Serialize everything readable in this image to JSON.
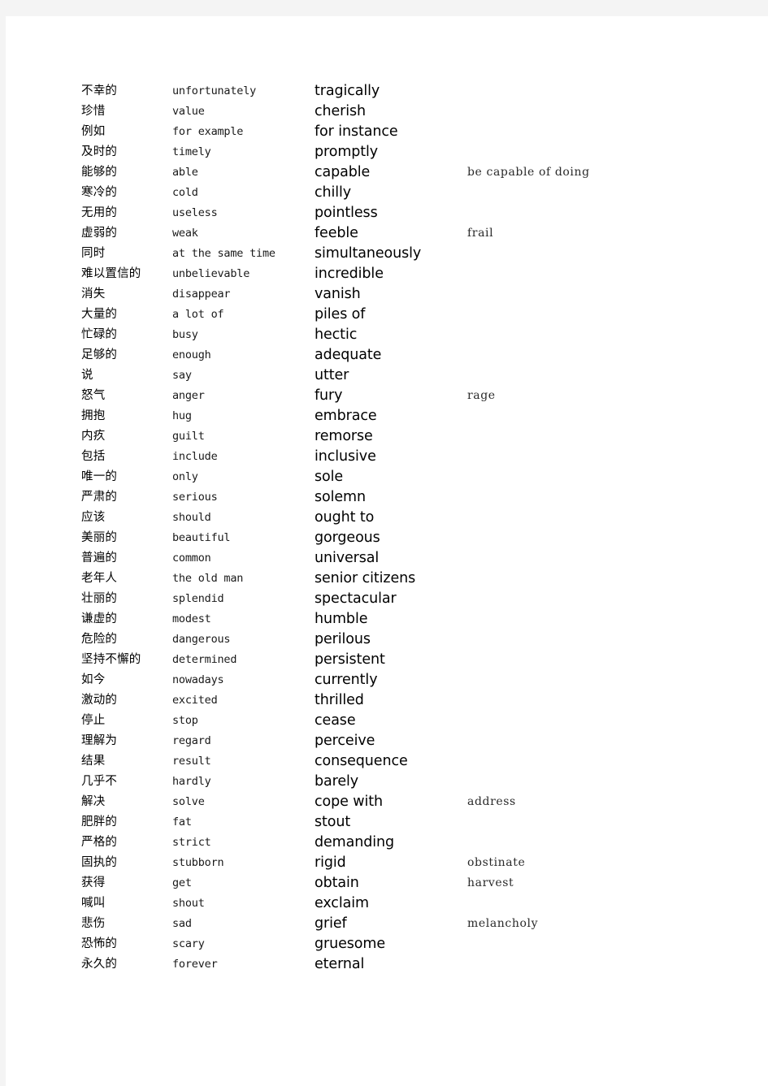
{
  "page": {
    "background_color": "#f4f4f4",
    "paper_color": "#ffffff"
  },
  "columns": {
    "chinese_header": "",
    "basic_header": "",
    "advanced_header": "",
    "extra_header": ""
  },
  "rows": [
    {
      "chinese": "不幸的",
      "basic": "unfortunately",
      "advanced": "tragically",
      "extra": ""
    },
    {
      "chinese": "珍惜",
      "basic": "value",
      "advanced": "cherish",
      "extra": ""
    },
    {
      "chinese": "例如",
      "basic": "for example",
      "advanced": "for instance",
      "extra": ""
    },
    {
      "chinese": "及时的",
      "basic": "timely",
      "advanced": "promptly",
      "extra": ""
    },
    {
      "chinese": "能够的",
      "basic": "able",
      "advanced": "capable",
      "extra": "be capable of doing"
    },
    {
      "chinese": "寒冷的",
      "basic": "cold",
      "advanced": "chilly",
      "extra": ""
    },
    {
      "chinese": "无用的",
      "basic": "useless",
      "advanced": "pointless",
      "extra": ""
    },
    {
      "chinese": "虚弱的",
      "basic": "weak",
      "advanced": "feeble",
      "extra": "frail"
    },
    {
      "chinese": "同时",
      "basic": "at the same time",
      "advanced": "simultaneously",
      "extra": ""
    },
    {
      "chinese": "难以置信的",
      "basic": "unbelievable",
      "advanced": "incredible",
      "extra": ""
    },
    {
      "chinese": "消失",
      "basic": "disappear",
      "advanced": "vanish",
      "extra": ""
    },
    {
      "chinese": "大量的",
      "basic": "a lot of",
      "advanced": "piles of",
      "extra": ""
    },
    {
      "chinese": "忙碌的",
      "basic": "busy",
      "advanced": "hectic",
      "extra": ""
    },
    {
      "chinese": "足够的",
      "basic": "enough",
      "advanced": "adequate",
      "extra": ""
    },
    {
      "chinese": "说",
      "basic": "say",
      "advanced": "utter",
      "extra": ""
    },
    {
      "chinese": "怒气",
      "basic": "anger",
      "advanced": "fury",
      "extra": "rage"
    },
    {
      "chinese": "拥抱",
      "basic": "hug",
      "advanced": "embrace",
      "extra": ""
    },
    {
      "chinese": "内疚",
      "basic": "guilt",
      "advanced": "remorse",
      "extra": ""
    },
    {
      "chinese": "包括",
      "basic": "include",
      "advanced": "inclusive",
      "extra": ""
    },
    {
      "chinese": "唯一的",
      "basic": "only",
      "advanced": "sole",
      "extra": ""
    },
    {
      "chinese": "严肃的",
      "basic": "serious",
      "advanced": "solemn",
      "extra": ""
    },
    {
      "chinese": "应该",
      "basic": "should",
      "advanced": "ought to",
      "extra": ""
    },
    {
      "chinese": "美丽的",
      "basic": "beautiful",
      "advanced": "gorgeous",
      "extra": ""
    },
    {
      "chinese": "普遍的",
      "basic": "common",
      "advanced": "universal",
      "extra": ""
    },
    {
      "chinese": "老年人",
      "basic": "the old man",
      "advanced": "senior citizens",
      "extra": ""
    },
    {
      "chinese": "壮丽的",
      "basic": "splendid",
      "advanced": "spectacular",
      "extra": ""
    },
    {
      "chinese": "谦虚的",
      "basic": "modest",
      "advanced": "humble",
      "extra": ""
    },
    {
      "chinese": "危险的",
      "basic": "dangerous",
      "advanced": "perilous",
      "extra": ""
    },
    {
      "chinese": "坚持不懈的",
      "basic": "determined",
      "advanced": "persistent",
      "extra": ""
    },
    {
      "chinese": "如今",
      "basic": "nowadays",
      "advanced": "currently",
      "extra": ""
    },
    {
      "chinese": "激动的",
      "basic": "excited",
      "advanced": "thrilled",
      "extra": ""
    },
    {
      "chinese": "停止",
      "basic": "stop",
      "advanced": "cease",
      "extra": ""
    },
    {
      "chinese": "理解为",
      "basic": "regard",
      "advanced": "perceive",
      "extra": ""
    },
    {
      "chinese": "结果",
      "basic": "result",
      "advanced": "consequence",
      "extra": ""
    },
    {
      "chinese": "几乎不",
      "basic": "hardly",
      "advanced": "barely",
      "extra": ""
    },
    {
      "chinese": "解决",
      "basic": "solve",
      "advanced": "cope with",
      "extra": "address"
    },
    {
      "chinese": "肥胖的",
      "basic": "fat",
      "advanced": "stout",
      "extra": ""
    },
    {
      "chinese": "严格的",
      "basic": "strict",
      "advanced": "demanding",
      "extra": ""
    },
    {
      "chinese": "固执的",
      "basic": "stubborn",
      "advanced": "rigid",
      "extra": "obstinate"
    },
    {
      "chinese": "获得",
      "basic": "get",
      "advanced": "obtain",
      "extra": "harvest"
    },
    {
      "chinese": "喊叫",
      "basic": "shout",
      "advanced": "exclaim",
      "extra": ""
    },
    {
      "chinese": "悲伤",
      "basic": "sad",
      "advanced": "grief",
      "extra": "melancholy"
    },
    {
      "chinese": "恐怖的",
      "basic": "scary",
      "advanced": "gruesome",
      "extra": ""
    },
    {
      "chinese": "永久的",
      "basic": "forever",
      "advanced": "eternal",
      "extra": ""
    }
  ]
}
